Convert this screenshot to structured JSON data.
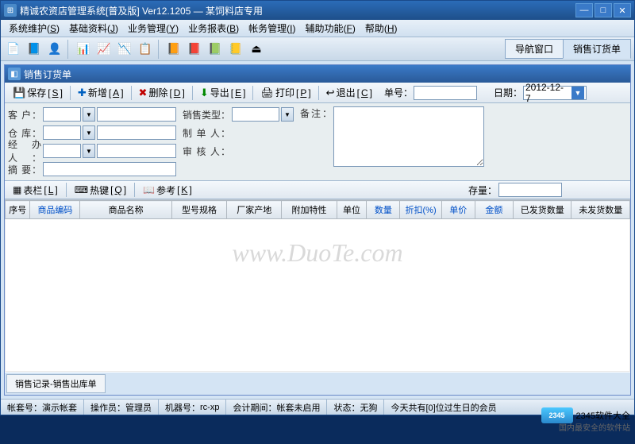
{
  "window": {
    "title": "精诚农资店管理系统[普及版]  Ver12.1205 — 某饲料店专用"
  },
  "menubar": [
    {
      "label": "系统维护",
      "key": "S"
    },
    {
      "label": "基础资料",
      "key": "J"
    },
    {
      "label": "业务管理",
      "key": "Y"
    },
    {
      "label": "业务报表",
      "key": "B"
    },
    {
      "label": "帐务管理",
      "key": "I"
    },
    {
      "label": "辅助功能",
      "key": "F"
    },
    {
      "label": "帮助",
      "key": "H"
    }
  ],
  "top_tabs": [
    {
      "label": "导航窗口",
      "active": false
    },
    {
      "label": "销售订货单",
      "active": true
    }
  ],
  "panel": {
    "title": "销售订货单"
  },
  "actions": {
    "save": "保存",
    "save_key": "S",
    "add": "新增",
    "add_key": "A",
    "delete": "删除",
    "delete_key": "D",
    "export": "导出",
    "export_key": "E",
    "print": "打印",
    "print_key": "P",
    "exit": "退出",
    "exit_key": "C",
    "doc_no_label": "单号：",
    "doc_no": "",
    "date_label": "日期：",
    "date": "2012-12- 7"
  },
  "form": {
    "customer_label": "客  户：",
    "warehouse_label": "仓  库：",
    "handler_label": "经办人：",
    "summary_label": "摘  要：",
    "sale_type_label": "销售类型：",
    "maker_label": "制 单 人：",
    "auditor_label": "审 核 人：",
    "remark_label": "备注："
  },
  "midbar": {
    "columns": "表栏",
    "columns_key": "L",
    "hotkey": "热键",
    "hotkey_key": "Q",
    "ref": "参考",
    "ref_key": "K",
    "stock_label": "存量："
  },
  "grid_cols": [
    {
      "label": "序号",
      "w": 30,
      "link": false
    },
    {
      "label": "商品编码",
      "w": 60,
      "link": true
    },
    {
      "label": "商品名称",
      "w": 110,
      "link": false
    },
    {
      "label": "型号规格",
      "w": 66,
      "link": false
    },
    {
      "label": "厂家产地",
      "w": 66,
      "link": false
    },
    {
      "label": "附加特性",
      "w": 66,
      "link": false
    },
    {
      "label": "单位",
      "w": 36,
      "link": false
    },
    {
      "label": "数量",
      "w": 40,
      "link": true
    },
    {
      "label": "折扣(%)",
      "w": 50,
      "link": true
    },
    {
      "label": "单价",
      "w": 40,
      "link": true
    },
    {
      "label": "金额",
      "w": 46,
      "link": true
    },
    {
      "label": "已发货数量",
      "w": 70,
      "link": false
    },
    {
      "label": "未发货数量",
      "w": 70,
      "link": false
    }
  ],
  "footer_tab": "销售记录-销售出库单",
  "status": {
    "account_label": "帐套号：",
    "account": "演示帐套",
    "operator_label": "操作员：",
    "operator": "管理员",
    "machine_label": "机器号：",
    "machine": "rc-xp",
    "period_label": "会计期间：",
    "period": "帐套未启用",
    "state_label": "状态：",
    "state": "无狗",
    "birthday": "今天共有[0]位过生日的会员"
  },
  "badge": {
    "text": "2345软件大全",
    "sub": "国内最安全的软件站"
  },
  "watermark": "www.DuoTe.com"
}
